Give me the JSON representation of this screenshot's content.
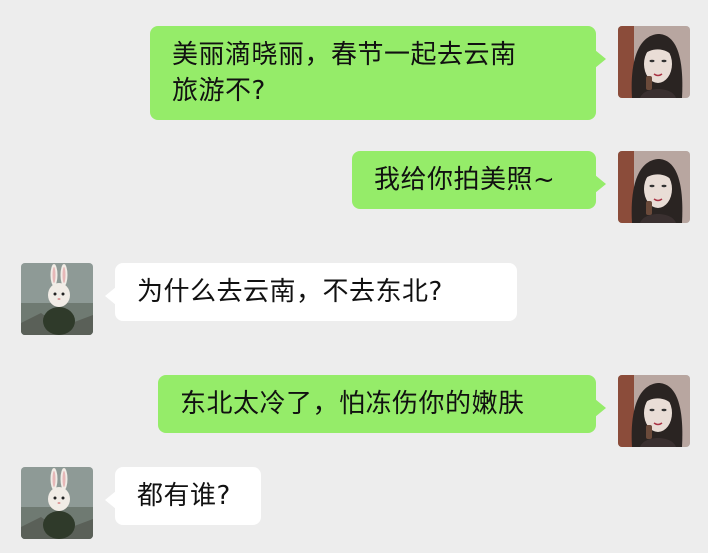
{
  "messages": [
    {
      "side": "right",
      "sender": "xiaoli",
      "text": "美丽滴晓丽，春节一起去云南\n旅游不?"
    },
    {
      "side": "right",
      "sender": "xiaoli",
      "text": "我给你拍美照~"
    },
    {
      "side": "left",
      "sender": "rabbit",
      "text": "为什么去云南，不去东北?"
    },
    {
      "side": "right",
      "sender": "xiaoli",
      "text": "东北太冷了，怕冻伤你的嫩肤"
    },
    {
      "side": "left",
      "sender": "rabbit",
      "text": "都有谁?"
    }
  ],
  "colors": {
    "background": "#ededed",
    "outgoing_bubble": "#95ec69",
    "incoming_bubble": "#ffffff"
  }
}
